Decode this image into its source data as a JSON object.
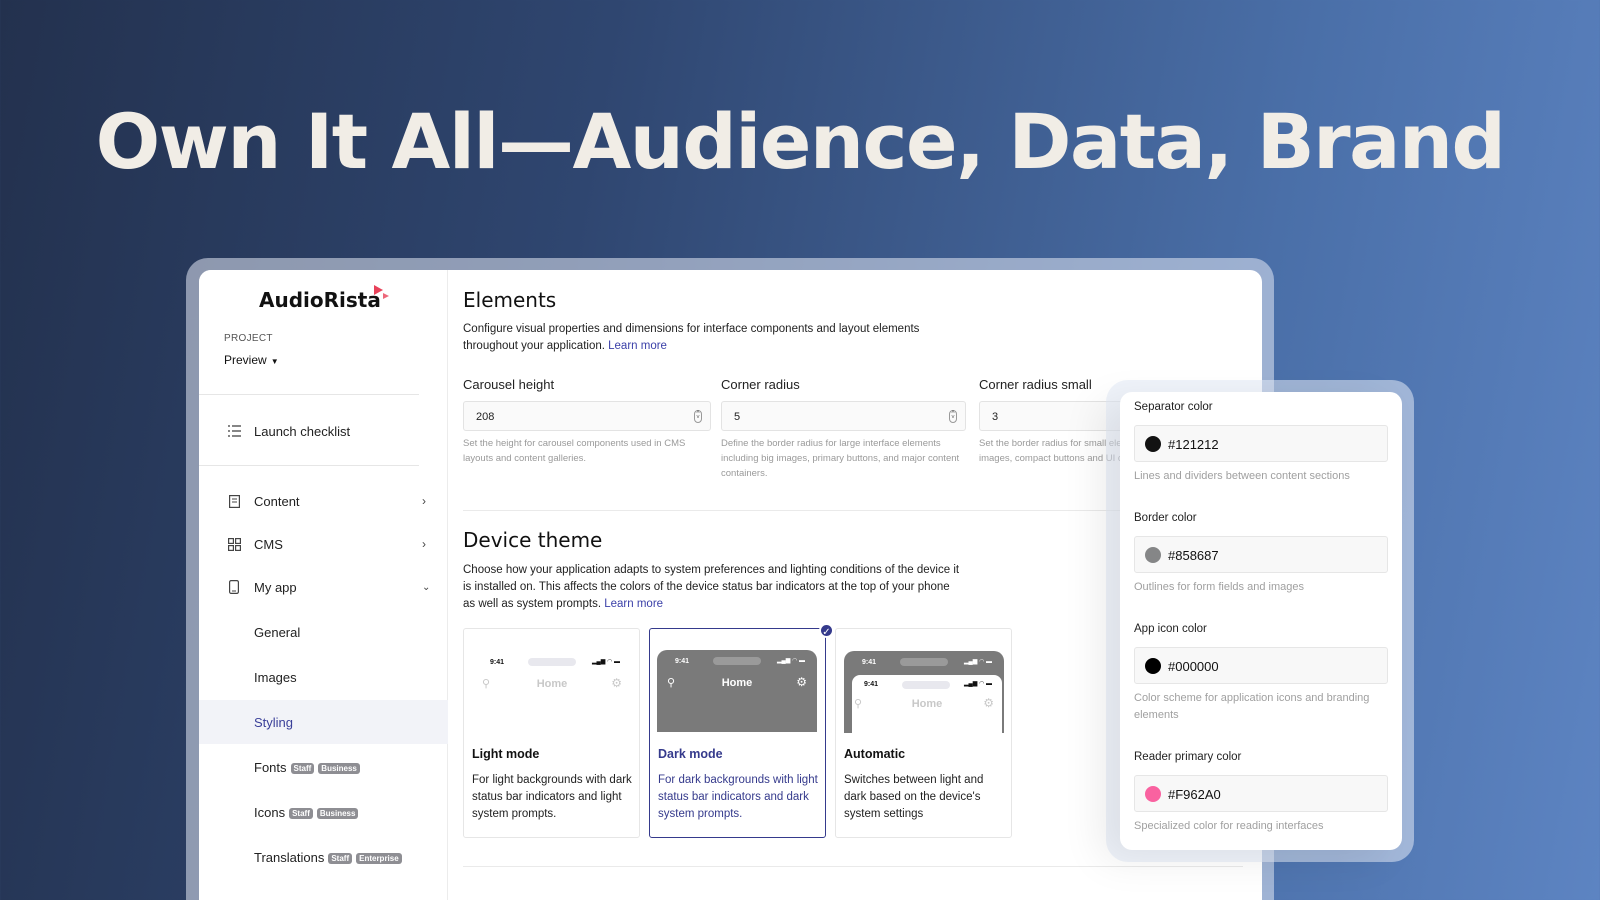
{
  "headline": "Own It All—Audience, Data, Brand",
  "sidebar": {
    "logo": "AudioRista",
    "project_label": "PROJECT",
    "project_value": "Preview",
    "launch_checklist": "Launch checklist",
    "items": [
      {
        "label": "Content"
      },
      {
        "label": "CMS"
      },
      {
        "label": "My app"
      },
      {
        "label": "General"
      },
      {
        "label": "Images"
      },
      {
        "label": "Styling"
      },
      {
        "label": "Fonts",
        "badges": [
          "Staff",
          "Business"
        ]
      },
      {
        "label": "Icons",
        "badges": [
          "Staff",
          "Business"
        ]
      },
      {
        "label": "Translations",
        "badges": [
          "Staff",
          "Enterprise"
        ]
      }
    ]
  },
  "elements": {
    "title": "Elements",
    "description": "Configure visual properties and dimensions for interface components and layout elements throughout your application.",
    "learn_more": "Learn more",
    "fields": [
      {
        "label": "Carousel height",
        "value": "208",
        "help": "Set the height for carousel components used in CMS layouts and content galleries."
      },
      {
        "label": "Corner radius",
        "value": "5",
        "help": "Define the border radius for large interface elements including big images, primary buttons, and major content containers."
      },
      {
        "label": "Corner radius small",
        "value": "3",
        "help": "Set the border radius for small elements such as small images, compact buttons and UI components."
      }
    ]
  },
  "device_theme": {
    "title": "Device theme",
    "description": "Choose how your application adapts to system preferences and lighting conditions of the device it is installed on. This affects the colors of the device status bar indicators at the top of your phone as well as system prompts.",
    "learn_more": "Learn more",
    "phone": {
      "time": "9:41",
      "home": "Home"
    },
    "options": [
      {
        "title": "Light mode",
        "description": "For light backgrounds with dark status bar indicators and light system prompts."
      },
      {
        "title": "Dark mode",
        "description": "For dark backgrounds with light status bar indicators and dark system prompts.",
        "selected": true
      },
      {
        "title": "Automatic",
        "description": "Switches between light and dark based on the device's system settings"
      }
    ]
  },
  "color_panel": {
    "items": [
      {
        "label": "Separator color",
        "value": "#121212",
        "swatch": "#121212",
        "help": "Lines and dividers between content sections"
      },
      {
        "label": "Border color",
        "value": "#858687",
        "swatch": "#858687",
        "help": "Outlines for form fields and images"
      },
      {
        "label": "App icon color",
        "value": "#000000",
        "swatch": "#000000",
        "help": "Color scheme for application icons and branding elements"
      },
      {
        "label": "Reader primary color",
        "value": "#F962A0",
        "swatch": "#F962A0",
        "help": "Specialized color for reading interfaces"
      }
    ]
  },
  "colors": {
    "accent": "#353a8c",
    "logo_mark": "#e8425a"
  }
}
